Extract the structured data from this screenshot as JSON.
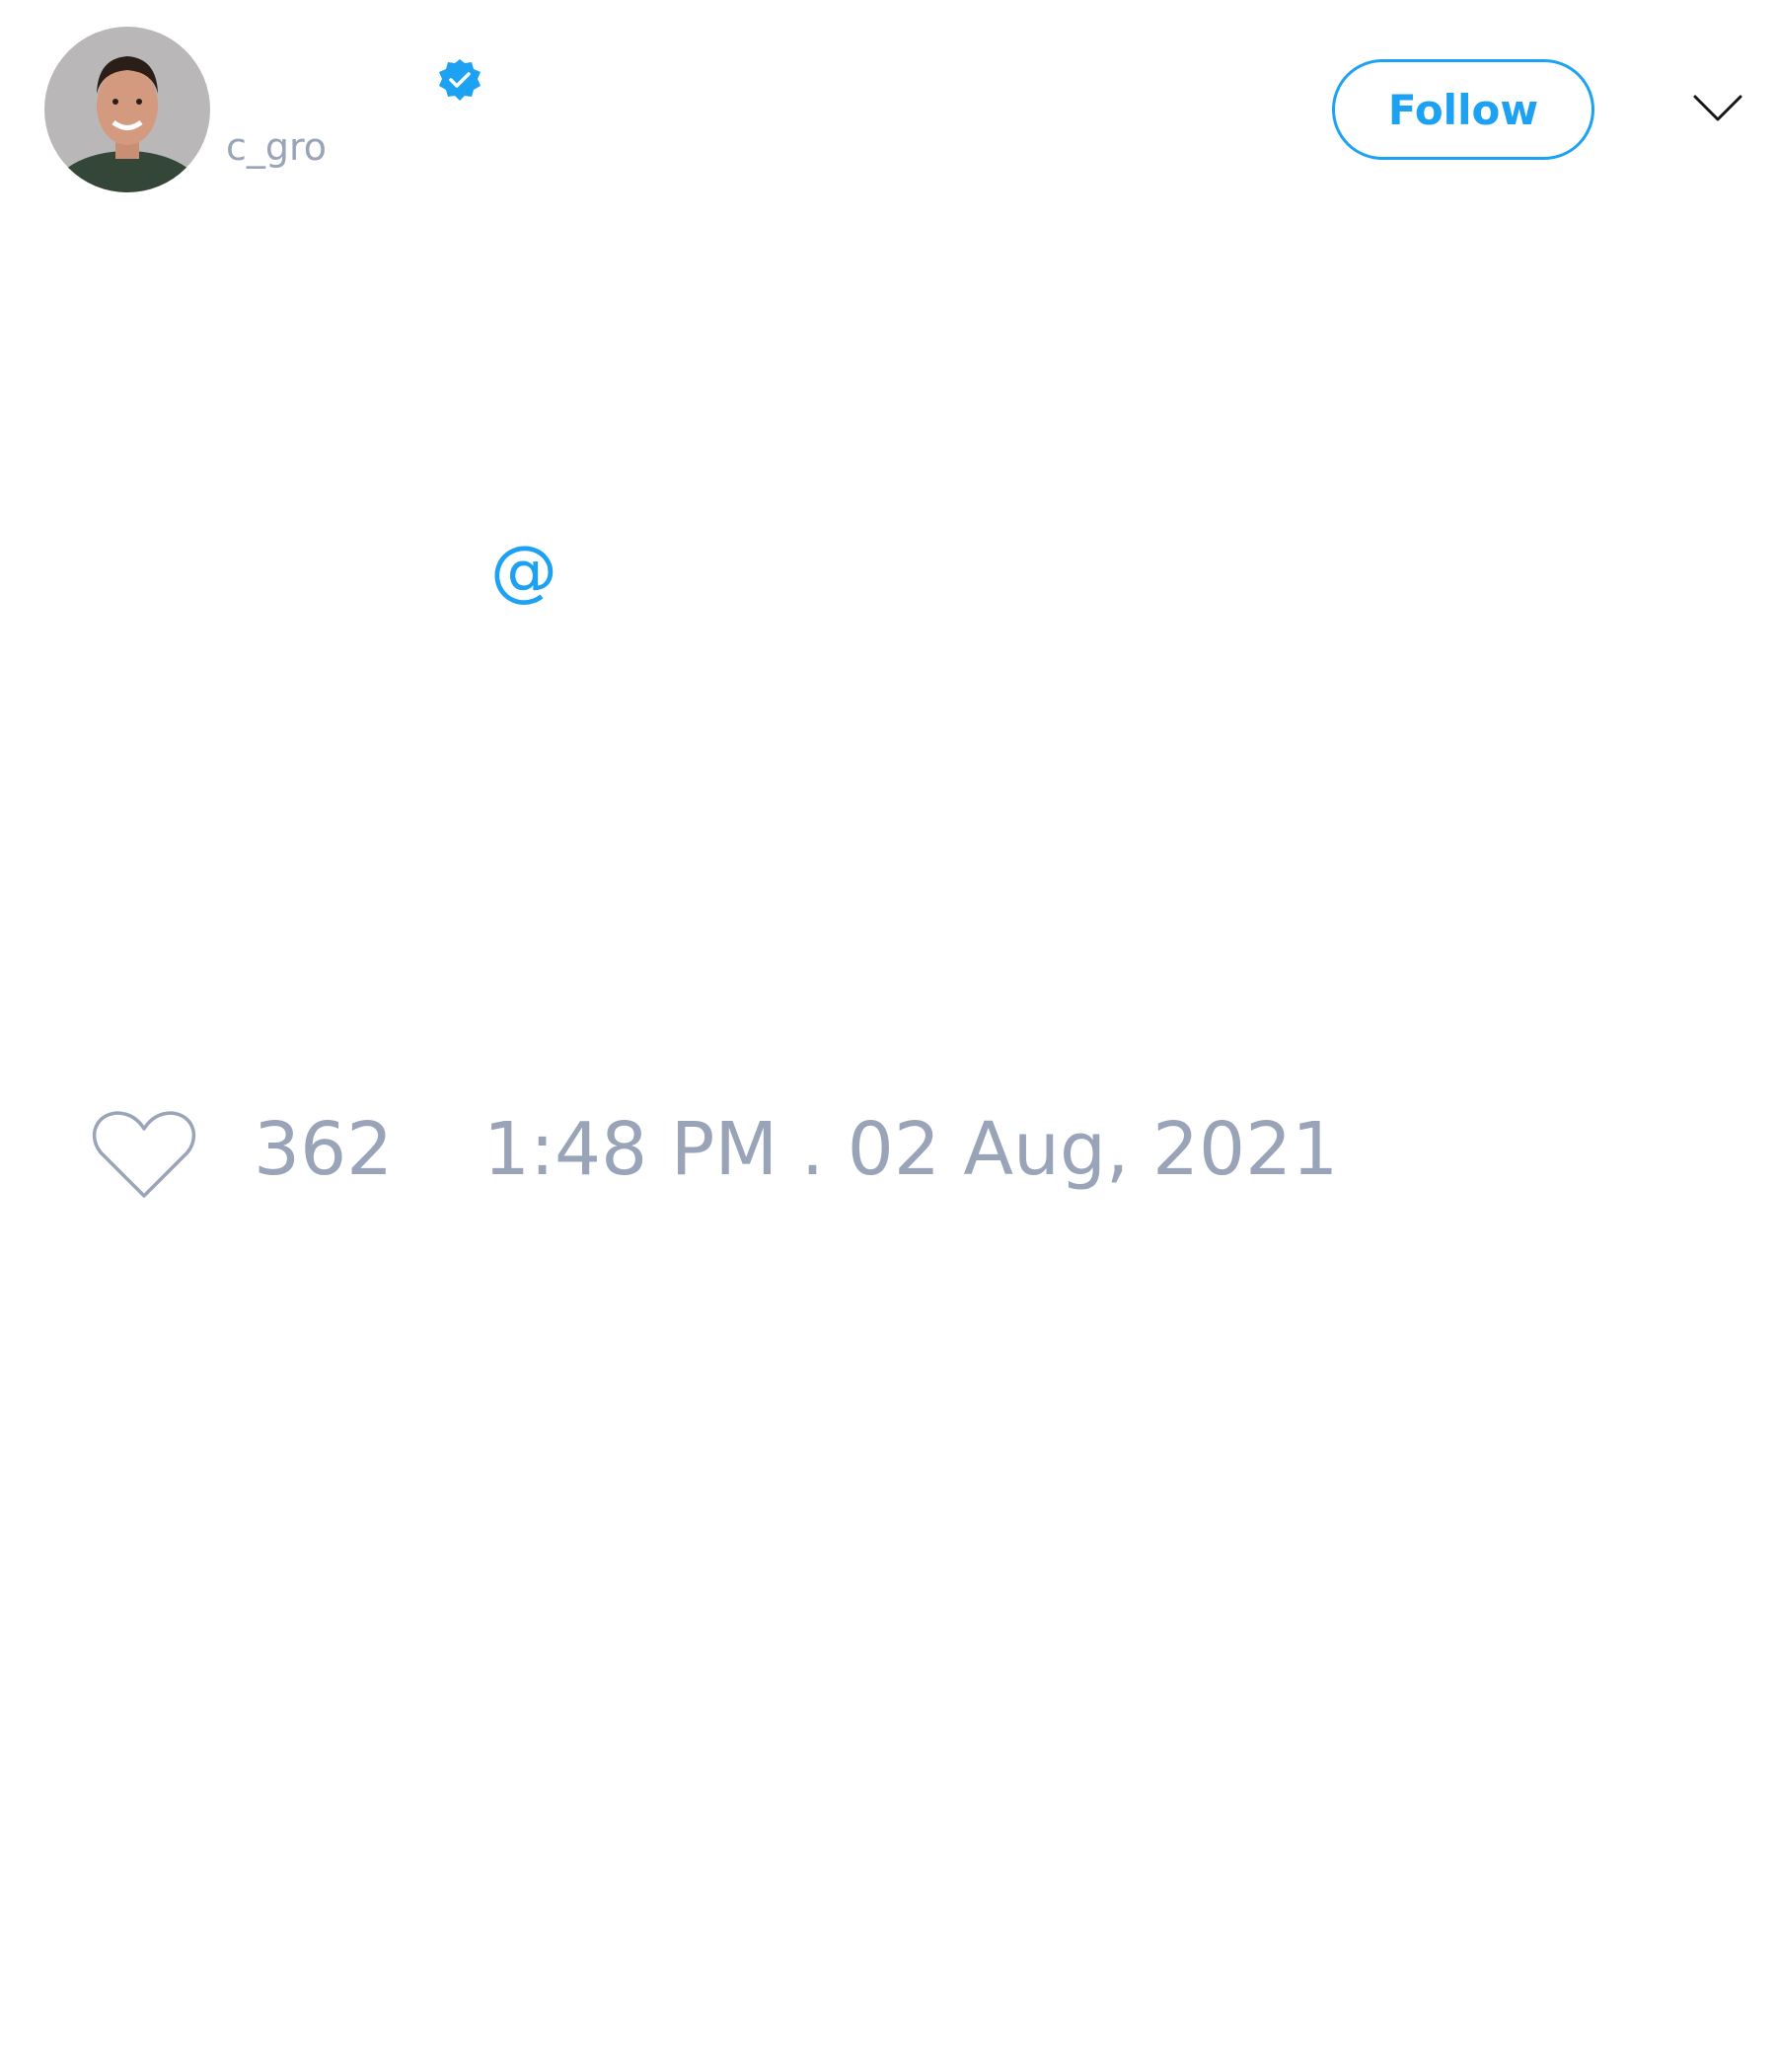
{
  "author": {
    "display_name": "",
    "handle": "c_gro",
    "verified": true,
    "avatar_icon": "profile-photo"
  },
  "actions": {
    "follow_label": "Follow",
    "menu_icon": "chevron-down-icon"
  },
  "tweet": {
    "text": "",
    "mention": "@"
  },
  "stats": {
    "like_icon": "heart-outline-icon",
    "like_count": "362",
    "timestamp": "1:48 PM . 02 Aug, 2021"
  },
  "colors": {
    "accent": "#1da1f2",
    "muted_text": "#9aa4b8",
    "background": "#ffffff"
  }
}
